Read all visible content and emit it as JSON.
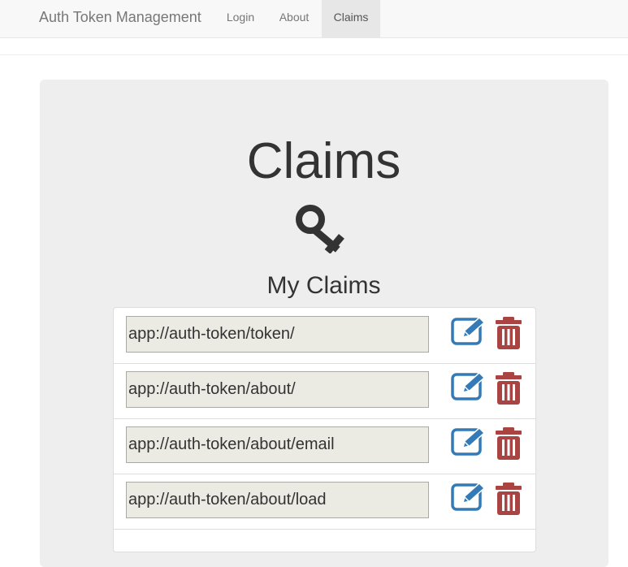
{
  "app": {
    "brand": "Auth Token Management"
  },
  "nav": {
    "items": [
      {
        "label": "Login",
        "active": false
      },
      {
        "label": "About",
        "active": false
      },
      {
        "label": "Claims",
        "active": true
      }
    ]
  },
  "main": {
    "title": "Claims",
    "title_icon": "key-icon",
    "section_title": "My Claims",
    "claims": [
      {
        "value": "app://auth-token/token/"
      },
      {
        "value": "app://auth-token/about/"
      },
      {
        "value": "app://auth-token/about/email"
      },
      {
        "value": "app://auth-token/about/load"
      }
    ],
    "row_actions": {
      "edit_icon": "edit-icon",
      "delete_icon": "trash-icon"
    }
  },
  "colors": {
    "edit": "#337ab7",
    "delete": "#a94442",
    "jumbotron": "#eeeeee",
    "navbar": "#f8f8f8",
    "input_bg": "#ebebe4"
  }
}
